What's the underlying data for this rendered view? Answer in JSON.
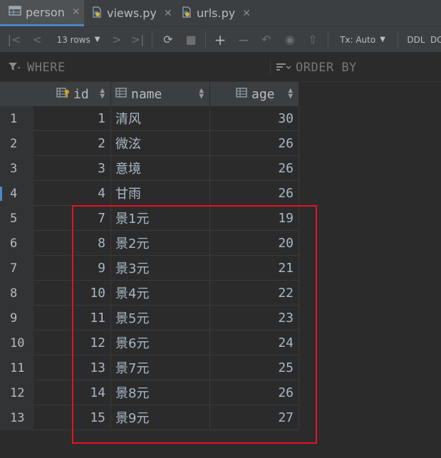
{
  "tabs": [
    {
      "label": "person",
      "icon": "table-icon",
      "active": true
    },
    {
      "label": "views.py",
      "icon": "python-file-icon",
      "active": false
    },
    {
      "label": "urls.py",
      "icon": "python-file-icon",
      "active": false
    }
  ],
  "toolbar": {
    "rows_label": "13 rows",
    "tx_label": "Tx: Auto",
    "ddl_label": "DDL",
    "dc_label": "DC"
  },
  "filter": {
    "where_label": "WHERE",
    "orderby_label": "ORDER BY"
  },
  "columns": [
    {
      "label": "id"
    },
    {
      "label": "name"
    },
    {
      "label": "age"
    }
  ],
  "rows": [
    {
      "n": "1",
      "id": "1",
      "name": "清风",
      "age": "30"
    },
    {
      "n": "2",
      "id": "2",
      "name": "微泫",
      "age": "26"
    },
    {
      "n": "3",
      "id": "3",
      "name": "意境",
      "age": "26"
    },
    {
      "n": "4",
      "id": "4",
      "name": "甘雨",
      "age": "26"
    },
    {
      "n": "5",
      "id": "7",
      "name": "景1元",
      "age": "19"
    },
    {
      "n": "6",
      "id": "8",
      "name": "景2元",
      "age": "20"
    },
    {
      "n": "7",
      "id": "9",
      "name": "景3元",
      "age": "21"
    },
    {
      "n": "8",
      "id": "10",
      "name": "景4元",
      "age": "22"
    },
    {
      "n": "9",
      "id": "11",
      "name": "景5元",
      "age": "23"
    },
    {
      "n": "10",
      "id": "12",
      "name": "景6元",
      "age": "24"
    },
    {
      "n": "11",
      "id": "13",
      "name": "景7元",
      "age": "25"
    },
    {
      "n": "12",
      "id": "14",
      "name": "景8元",
      "age": "26"
    },
    {
      "n": "13",
      "id": "15",
      "name": "景9元",
      "age": "27"
    }
  ],
  "colors": {
    "accent": "#4a88c7",
    "highlight_box": "#e81123"
  }
}
